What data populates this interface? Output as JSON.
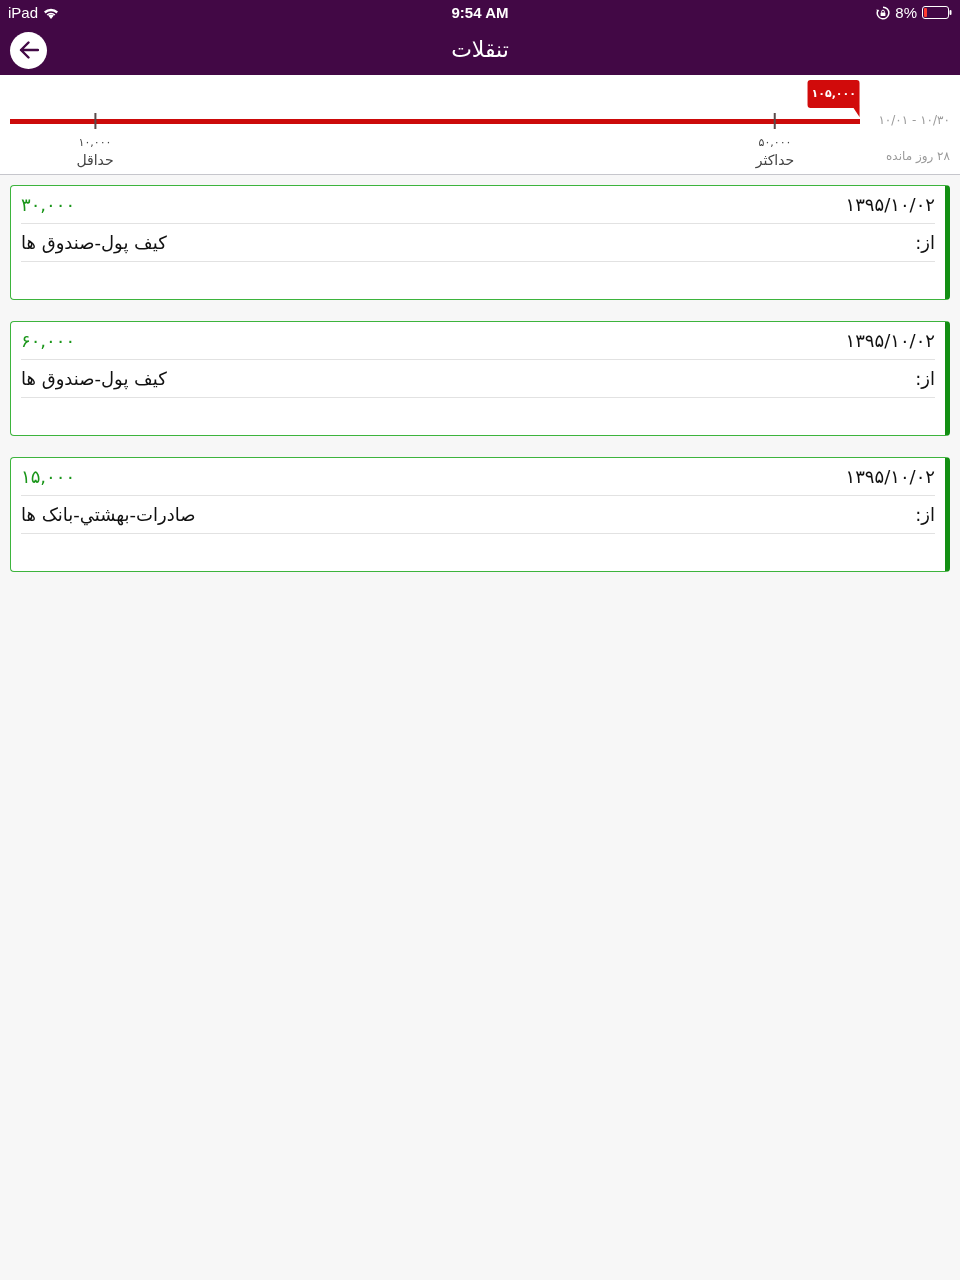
{
  "status_bar": {
    "device": "iPad",
    "time": "9:54 AM",
    "battery": "8%"
  },
  "nav": {
    "title": "تنقلات"
  },
  "budget": {
    "level": 1,
    "spent": "۱۰۵,۰۰۰",
    "markers": [
      {
        "kind": "max",
        "value": "۵۰,۰۰۰",
        "label": "حداکثر"
      },
      {
        "kind": "min",
        "value": "۱۰,۰۰۰",
        "label": "حداقل"
      }
    ],
    "period": "۱۰/۰۱ - ۱۰/۳۰",
    "remaining": "۲۸ روز مانده"
  },
  "transactions": [
    {
      "date": "۱۳۹۵/۱۰/۰۲",
      "amount": "۳۰,۰۰۰",
      "from_label": "از:",
      "source": "کیف پول-صندوق ها"
    },
    {
      "date": "۱۳۹۵/۱۰/۰۲",
      "amount": "۶۰,۰۰۰",
      "from_label": "از:",
      "source": "کیف پول-صندوق ها"
    },
    {
      "date": "۱۳۹۵/۱۰/۰۲",
      "amount": "۱۵,۰۰۰",
      "from_label": "از:",
      "source": "صادرات-بهشتي-بانک ها"
    }
  ]
}
